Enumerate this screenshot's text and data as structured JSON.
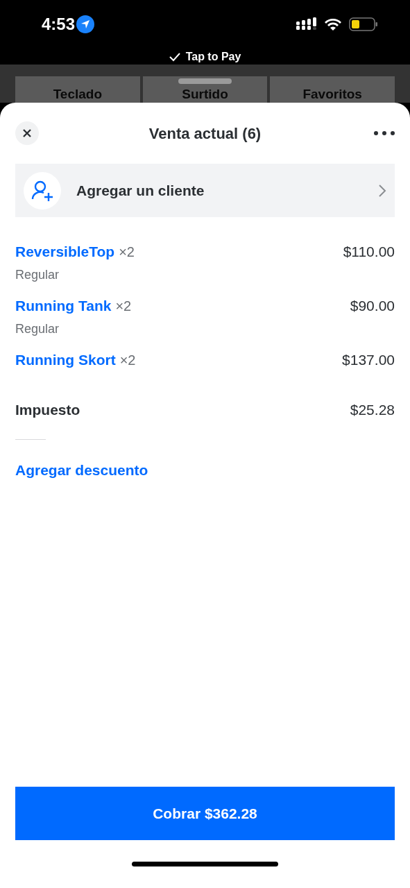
{
  "status_bar": {
    "time": "4:53"
  },
  "banner": {
    "label": "Tap to Pay"
  },
  "background_tabs": [
    {
      "label": "Teclado"
    },
    {
      "label": "Surtido"
    },
    {
      "label": "Favoritos"
    }
  ],
  "sheet": {
    "title": "Venta actual (6)"
  },
  "customer": {
    "label": "Agregar un cliente"
  },
  "items": [
    {
      "name": "ReversibleTop",
      "qty": "×2",
      "price": "$110.00",
      "variant": "Regular"
    },
    {
      "name": "Running Tank",
      "qty": "×2",
      "price": "$90.00",
      "variant": "Regular"
    },
    {
      "name": "Running Skort",
      "qty": "×2",
      "price": "$137.00"
    }
  ],
  "tax": {
    "label": "Impuesto",
    "amount": "$25.28"
  },
  "discount_link": "Agregar descuento",
  "charge_button": "Cobrar $362.28"
}
